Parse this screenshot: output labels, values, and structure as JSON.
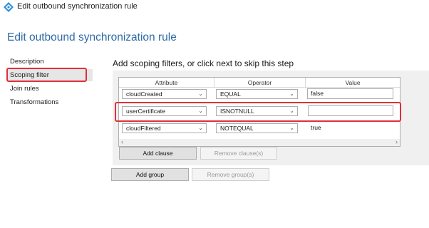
{
  "window": {
    "title": "Edit outbound synchronization rule"
  },
  "page": {
    "title": "Edit outbound synchronization rule"
  },
  "nav": {
    "items": [
      {
        "label": "Description"
      },
      {
        "label": "Scoping filter"
      },
      {
        "label": "Join rules"
      },
      {
        "label": "Transformations"
      }
    ],
    "active": "Scoping filter"
  },
  "scoping": {
    "heading": "Add scoping filters, or click next to skip this step",
    "columns": {
      "attribute": "Attribute",
      "operator": "Operator",
      "value": "Value"
    },
    "rows": [
      {
        "attribute": "cloudCreated",
        "operator": "EQUAL",
        "value": "false"
      },
      {
        "attribute": "userCertificate",
        "operator": "ISNOTNULL",
        "value": ""
      },
      {
        "attribute": "cloudFiltered",
        "operator": "NOTEQUAL",
        "value": "true"
      }
    ],
    "add_clause": "Add clause",
    "remove_clause": "Remove clause(s)"
  },
  "footer": {
    "add_group": "Add group",
    "remove_group": "Remove group(s)"
  },
  "colors": {
    "accent": "#2e6aa6",
    "highlight": "#e0303a",
    "icon": "#2d8fd5"
  }
}
